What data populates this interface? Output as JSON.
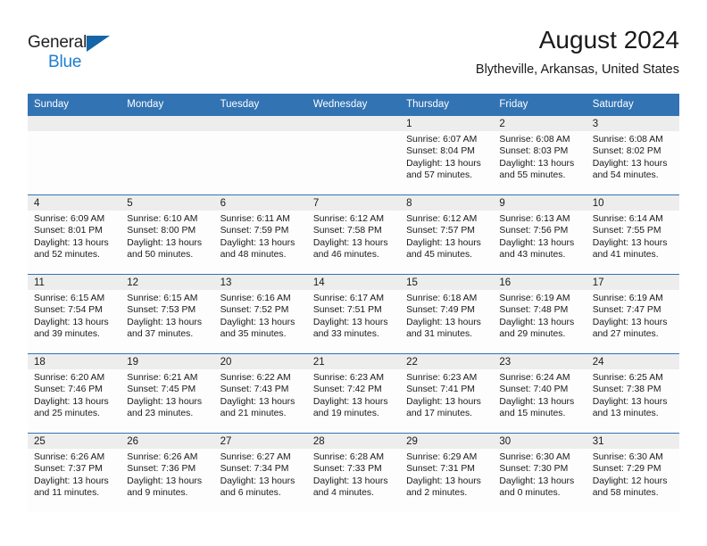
{
  "brand": {
    "name_part1": "General",
    "name_part2": "Blue",
    "triangle_color": "#1565a8",
    "blue_text_color": "#1c7fd0"
  },
  "header": {
    "title": "August 2024",
    "subtitle": "Blytheville, Arkansas, United States"
  },
  "theme": {
    "header_blue": "#3273b3",
    "daynum_band": "#ededed",
    "cell_background": "#fdfdfd"
  },
  "weekday_headers": [
    "Sunday",
    "Monday",
    "Tuesday",
    "Wednesday",
    "Thursday",
    "Friday",
    "Saturday"
  ],
  "labels": {
    "sunrise_prefix": "Sunrise:",
    "sunset_prefix": "Sunset:",
    "daylight_prefix": "Daylight:"
  },
  "weeks": [
    [
      {
        "day": "",
        "empty": true
      },
      {
        "day": "",
        "empty": true
      },
      {
        "day": "",
        "empty": true
      },
      {
        "day": "",
        "empty": true
      },
      {
        "day": "1",
        "sunrise": "Sunrise: 6:07 AM",
        "sunset": "Sunset: 8:04 PM",
        "daylight_line1": "Daylight: 13 hours",
        "daylight_line2": "and 57 minutes."
      },
      {
        "day": "2",
        "sunrise": "Sunrise: 6:08 AM",
        "sunset": "Sunset: 8:03 PM",
        "daylight_line1": "Daylight: 13 hours",
        "daylight_line2": "and 55 minutes."
      },
      {
        "day": "3",
        "sunrise": "Sunrise: 6:08 AM",
        "sunset": "Sunset: 8:02 PM",
        "daylight_line1": "Daylight: 13 hours",
        "daylight_line2": "and 54 minutes."
      }
    ],
    [
      {
        "day": "4",
        "sunrise": "Sunrise: 6:09 AM",
        "sunset": "Sunset: 8:01 PM",
        "daylight_line1": "Daylight: 13 hours",
        "daylight_line2": "and 52 minutes."
      },
      {
        "day": "5",
        "sunrise": "Sunrise: 6:10 AM",
        "sunset": "Sunset: 8:00 PM",
        "daylight_line1": "Daylight: 13 hours",
        "daylight_line2": "and 50 minutes."
      },
      {
        "day": "6",
        "sunrise": "Sunrise: 6:11 AM",
        "sunset": "Sunset: 7:59 PM",
        "daylight_line1": "Daylight: 13 hours",
        "daylight_line2": "and 48 minutes."
      },
      {
        "day": "7",
        "sunrise": "Sunrise: 6:12 AM",
        "sunset": "Sunset: 7:58 PM",
        "daylight_line1": "Daylight: 13 hours",
        "daylight_line2": "and 46 minutes."
      },
      {
        "day": "8",
        "sunrise": "Sunrise: 6:12 AM",
        "sunset": "Sunset: 7:57 PM",
        "daylight_line1": "Daylight: 13 hours",
        "daylight_line2": "and 45 minutes."
      },
      {
        "day": "9",
        "sunrise": "Sunrise: 6:13 AM",
        "sunset": "Sunset: 7:56 PM",
        "daylight_line1": "Daylight: 13 hours",
        "daylight_line2": "and 43 minutes."
      },
      {
        "day": "10",
        "sunrise": "Sunrise: 6:14 AM",
        "sunset": "Sunset: 7:55 PM",
        "daylight_line1": "Daylight: 13 hours",
        "daylight_line2": "and 41 minutes."
      }
    ],
    [
      {
        "day": "11",
        "sunrise": "Sunrise: 6:15 AM",
        "sunset": "Sunset: 7:54 PM",
        "daylight_line1": "Daylight: 13 hours",
        "daylight_line2": "and 39 minutes."
      },
      {
        "day": "12",
        "sunrise": "Sunrise: 6:15 AM",
        "sunset": "Sunset: 7:53 PM",
        "daylight_line1": "Daylight: 13 hours",
        "daylight_line2": "and 37 minutes."
      },
      {
        "day": "13",
        "sunrise": "Sunrise: 6:16 AM",
        "sunset": "Sunset: 7:52 PM",
        "daylight_line1": "Daylight: 13 hours",
        "daylight_line2": "and 35 minutes."
      },
      {
        "day": "14",
        "sunrise": "Sunrise: 6:17 AM",
        "sunset": "Sunset: 7:51 PM",
        "daylight_line1": "Daylight: 13 hours",
        "daylight_line2": "and 33 minutes."
      },
      {
        "day": "15",
        "sunrise": "Sunrise: 6:18 AM",
        "sunset": "Sunset: 7:49 PM",
        "daylight_line1": "Daylight: 13 hours",
        "daylight_line2": "and 31 minutes."
      },
      {
        "day": "16",
        "sunrise": "Sunrise: 6:19 AM",
        "sunset": "Sunset: 7:48 PM",
        "daylight_line1": "Daylight: 13 hours",
        "daylight_line2": "and 29 minutes."
      },
      {
        "day": "17",
        "sunrise": "Sunrise: 6:19 AM",
        "sunset": "Sunset: 7:47 PM",
        "daylight_line1": "Daylight: 13 hours",
        "daylight_line2": "and 27 minutes."
      }
    ],
    [
      {
        "day": "18",
        "sunrise": "Sunrise: 6:20 AM",
        "sunset": "Sunset: 7:46 PM",
        "daylight_line1": "Daylight: 13 hours",
        "daylight_line2": "and 25 minutes."
      },
      {
        "day": "19",
        "sunrise": "Sunrise: 6:21 AM",
        "sunset": "Sunset: 7:45 PM",
        "daylight_line1": "Daylight: 13 hours",
        "daylight_line2": "and 23 minutes."
      },
      {
        "day": "20",
        "sunrise": "Sunrise: 6:22 AM",
        "sunset": "Sunset: 7:43 PM",
        "daylight_line1": "Daylight: 13 hours",
        "daylight_line2": "and 21 minutes."
      },
      {
        "day": "21",
        "sunrise": "Sunrise: 6:23 AM",
        "sunset": "Sunset: 7:42 PM",
        "daylight_line1": "Daylight: 13 hours",
        "daylight_line2": "and 19 minutes."
      },
      {
        "day": "22",
        "sunrise": "Sunrise: 6:23 AM",
        "sunset": "Sunset: 7:41 PM",
        "daylight_line1": "Daylight: 13 hours",
        "daylight_line2": "and 17 minutes."
      },
      {
        "day": "23",
        "sunrise": "Sunrise: 6:24 AM",
        "sunset": "Sunset: 7:40 PM",
        "daylight_line1": "Daylight: 13 hours",
        "daylight_line2": "and 15 minutes."
      },
      {
        "day": "24",
        "sunrise": "Sunrise: 6:25 AM",
        "sunset": "Sunset: 7:38 PM",
        "daylight_line1": "Daylight: 13 hours",
        "daylight_line2": "and 13 minutes."
      }
    ],
    [
      {
        "day": "25",
        "sunrise": "Sunrise: 6:26 AM",
        "sunset": "Sunset: 7:37 PM",
        "daylight_line1": "Daylight: 13 hours",
        "daylight_line2": "and 11 minutes."
      },
      {
        "day": "26",
        "sunrise": "Sunrise: 6:26 AM",
        "sunset": "Sunset: 7:36 PM",
        "daylight_line1": "Daylight: 13 hours",
        "daylight_line2": "and 9 minutes."
      },
      {
        "day": "27",
        "sunrise": "Sunrise: 6:27 AM",
        "sunset": "Sunset: 7:34 PM",
        "daylight_line1": "Daylight: 13 hours",
        "daylight_line2": "and 6 minutes."
      },
      {
        "day": "28",
        "sunrise": "Sunrise: 6:28 AM",
        "sunset": "Sunset: 7:33 PM",
        "daylight_line1": "Daylight: 13 hours",
        "daylight_line2": "and 4 minutes."
      },
      {
        "day": "29",
        "sunrise": "Sunrise: 6:29 AM",
        "sunset": "Sunset: 7:31 PM",
        "daylight_line1": "Daylight: 13 hours",
        "daylight_line2": "and 2 minutes."
      },
      {
        "day": "30",
        "sunrise": "Sunrise: 6:30 AM",
        "sunset": "Sunset: 7:30 PM",
        "daylight_line1": "Daylight: 13 hours",
        "daylight_line2": "and 0 minutes."
      },
      {
        "day": "31",
        "sunrise": "Sunrise: 6:30 AM",
        "sunset": "Sunset: 7:29 PM",
        "daylight_line1": "Daylight: 12 hours",
        "daylight_line2": "and 58 minutes."
      }
    ]
  ]
}
